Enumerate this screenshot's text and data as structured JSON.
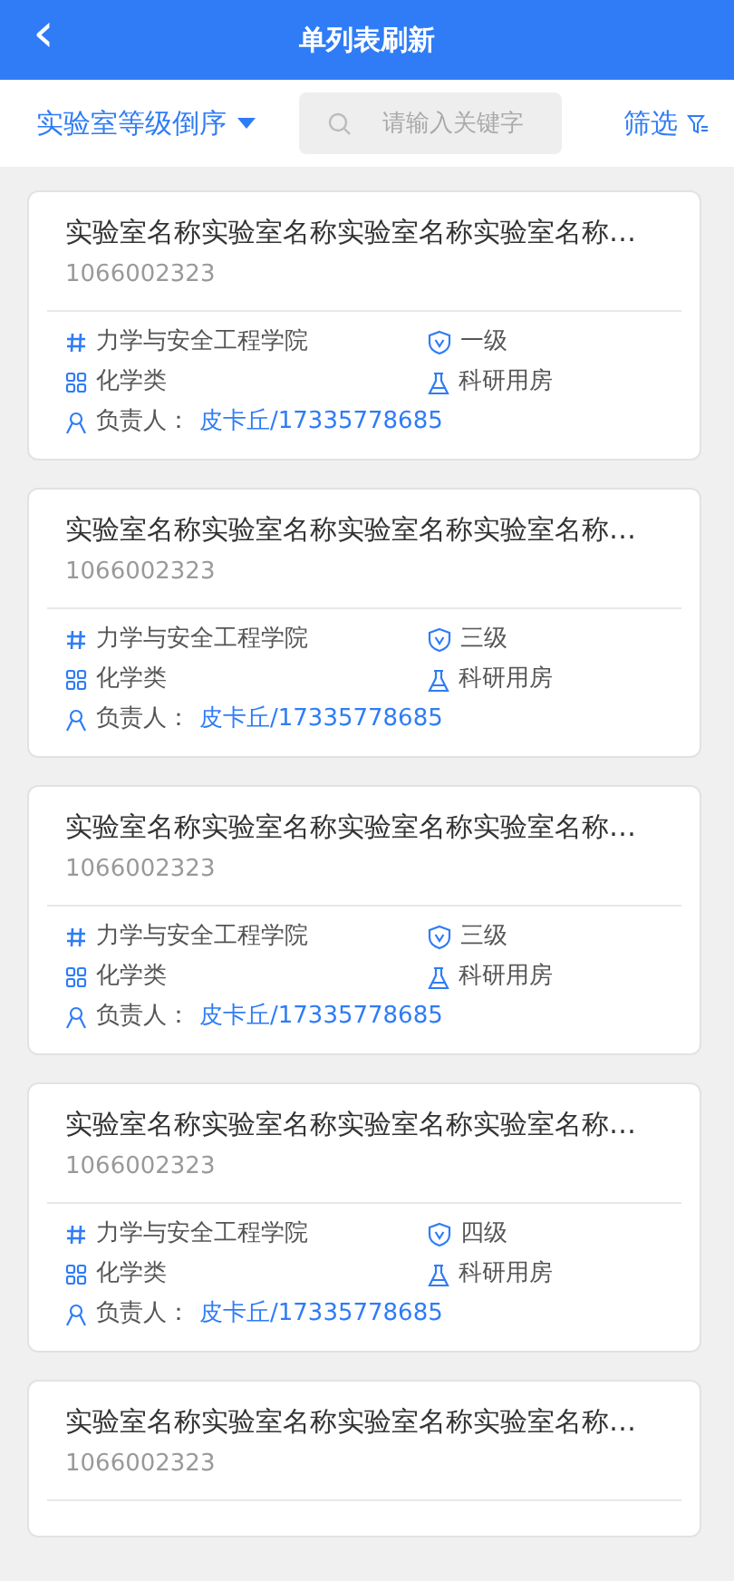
{
  "header": {
    "back_icon": "‹",
    "title": "单列表刷新"
  },
  "toolbar": {
    "sort": "实验室等级倒序",
    "search": {
      "placeholder": "请输入关键字"
    },
    "filter": "筛选"
  },
  "cards": [
    {
      "title": "实验室名称实验室名称实验室名称实验室名称…",
      "code": "1066002323",
      "college": "力学与安全工程学院",
      "level_text": "一级",
      "category": "化学类",
      "room_type": "科研用房",
      "manager_label": "负责人：",
      "manager": "皮卡丘/17335778685"
    },
    {
      "title": "实验室名称实验室名称实验室名称实验室名称…",
      "code": "1066002323",
      "college": "力学与安全工程学院",
      "level_text": "三级",
      "category": "化学类",
      "room_type": "科研用房",
      "manager_label": "负责人：",
      "manager": "皮卡丘/17335778685"
    },
    {
      "title": "实验室名称实验室名称实验室名称实验室名称…",
      "code": "1066002323",
      "college": "力学与安全工程学院",
      "level_text": "三级",
      "category": "化学类",
      "room_type": "科研用房",
      "manager_label": "负责人：",
      "manager": "皮卡丘/17335778685"
    },
    {
      "title": "实验室名称实验室名称实验室名称实验室名称…",
      "code": "1066002323",
      "college": "力学与安全工程学院",
      "level_text": "四级",
      "category": "化学类",
      "room_type": "科研用房",
      "manager_label": "负责人：",
      "manager": "皮卡丘/17335778685"
    },
    {
      "title": "实验室名称实验室名称实验室名称实验室名称…",
      "code": "1066002323"
    }
  ]
}
